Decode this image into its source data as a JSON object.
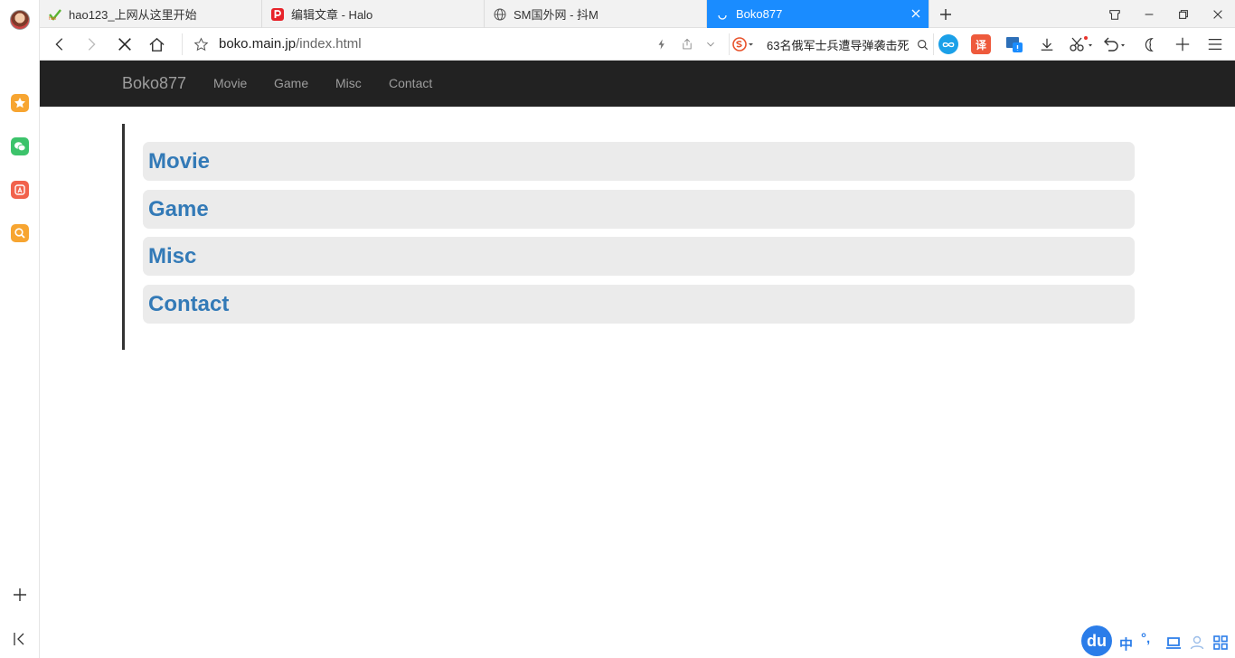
{
  "tabs": [
    {
      "title": "hao123_上网从这里开始",
      "icon": "hao123-icon"
    },
    {
      "title": "编辑文章 - Halo",
      "icon": "halo-icon"
    },
    {
      "title": "SM国外网 - 抖M",
      "icon": "globe-icon"
    },
    {
      "title": "Boko877",
      "icon": "loading-icon",
      "active": true
    }
  ],
  "address": {
    "host": "boko.main.jp",
    "path": "/index.html"
  },
  "search": {
    "text": "63名俄军士兵遭导弹袭击死"
  },
  "site": {
    "brand": "Boko877",
    "nav": [
      "Movie",
      "Game",
      "Misc",
      "Contact"
    ],
    "cards": [
      "Movie",
      "Game",
      "Misc",
      "Contact"
    ]
  },
  "ime": {
    "logo": "du",
    "lang": "中",
    "punct": "°,"
  },
  "ext": {
    "translate": "译"
  },
  "colors": {
    "accent": "#1a8cff",
    "navbar": "#222222",
    "link": "#337ab7",
    "card": "#ebebeb"
  }
}
